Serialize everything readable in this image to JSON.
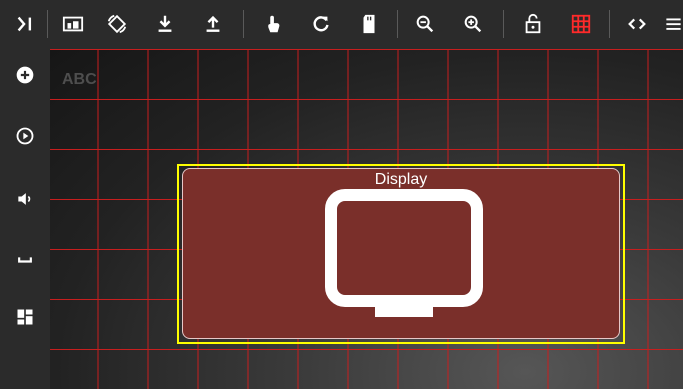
{
  "toolbar": {
    "buttons": [
      {
        "icon": "collapse-arrow-icon"
      },
      {
        "icon": "device-icon"
      },
      {
        "icon": "rotate-icon"
      },
      {
        "icon": "download-icon"
      },
      {
        "icon": "upload-icon"
      },
      {
        "icon": "touch-icon"
      },
      {
        "icon": "refresh-icon"
      },
      {
        "icon": "sd-card-icon"
      },
      {
        "icon": "zoom-out-icon"
      },
      {
        "icon": "zoom-in-icon"
      },
      {
        "icon": "lock-open-icon"
      },
      {
        "icon": "grid-icon",
        "active_color": "#ff2a2a"
      },
      {
        "icon": "code-icon"
      },
      {
        "icon": "menu-icon"
      }
    ]
  },
  "sidebar": {
    "buttons": [
      {
        "icon": "add-circle-icon"
      },
      {
        "icon": "play-circle-icon"
      },
      {
        "icon": "volume-icon"
      },
      {
        "icon": "space-icon"
      },
      {
        "icon": "dashboard-icon"
      }
    ]
  },
  "canvas": {
    "background_text": "ABC",
    "grid_color": "#c81e1e",
    "widget": {
      "title": "Display",
      "icon": "monitor-icon",
      "selection_color": "#ffff00",
      "fill_color": "#7a2f2a"
    }
  }
}
